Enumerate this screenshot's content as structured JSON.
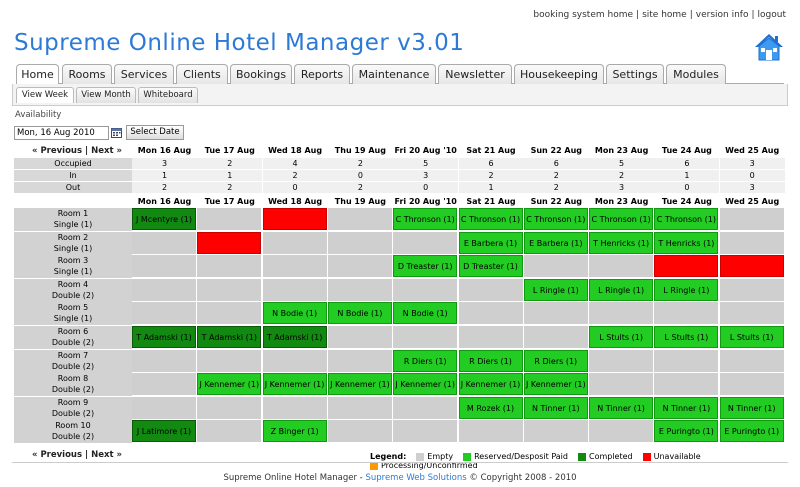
{
  "toplinks": [
    "booking system home",
    "site home",
    "version info",
    "logout"
  ],
  "title": "Supreme Online Hotel Manager v3.01",
  "tabs": [
    "Home",
    "Rooms",
    "Services",
    "Clients",
    "Bookings",
    "Reports",
    "Maintenance",
    "Newsletter",
    "Housekeeping",
    "Settings",
    "Modules"
  ],
  "subtabs": [
    "View Week",
    "View Month",
    "Whiteboard"
  ],
  "availability_label": "Availability",
  "date_value": "Mon, 16 Aug 2010",
  "select_date_label": "Select Date",
  "nav": {
    "prev": "« Previous",
    "sep": "|",
    "next": "Next »"
  },
  "days": [
    "Mon 16 Aug '10",
    "Tue 17 Aug '10",
    "Wed 18 Aug '10",
    "Thu 19 Aug '10",
    "Fri 20 Aug '10",
    "Sat 21 Aug '10",
    "Sun 22 Aug '10",
    "Mon 23 Aug '10",
    "Tue 24 Aug '10",
    "Wed 25 Aug '10"
  ],
  "stats": [
    {
      "label": "Occupied",
      "values": [
        "3",
        "2",
        "4",
        "2",
        "5",
        "6",
        "6",
        "5",
        "6",
        "3"
      ]
    },
    {
      "label": "In",
      "values": [
        "1",
        "1",
        "2",
        "0",
        "3",
        "2",
        "2",
        "2",
        "1",
        "0"
      ]
    },
    {
      "label": "Out",
      "values": [
        "2",
        "2",
        "0",
        "2",
        "0",
        "1",
        "2",
        "3",
        "0",
        "3"
      ]
    }
  ],
  "rooms": [
    {
      "name": "Room 1",
      "type": "Single (1)",
      "cells": [
        [
          "completed",
          "J Mcentyre (1)"
        ],
        [
          "",
          ""
        ],
        [
          "unavailable",
          ""
        ],
        [
          "",
          ""
        ],
        [
          "reserved",
          "C Thronson (1)"
        ],
        [
          "reserved",
          "C Thronson (1)"
        ],
        [
          "reserved",
          "C Thronson (1)"
        ],
        [
          "reserved",
          "C Thronson (1)"
        ],
        [
          "reserved",
          "C Thronson (1)"
        ],
        [
          "",
          ""
        ]
      ]
    },
    {
      "name": "Room 2",
      "type": "Single (1)",
      "cells": [
        [
          "",
          ""
        ],
        [
          "unavailable",
          ""
        ],
        [
          "",
          ""
        ],
        [
          "",
          ""
        ],
        [
          "",
          ""
        ],
        [
          "reserved",
          "E Barbera (1)"
        ],
        [
          "reserved",
          "E Barbera (1)"
        ],
        [
          "reserved",
          "T Henricks (1)"
        ],
        [
          "reserved",
          "T Henricks (1)"
        ],
        [
          "",
          ""
        ]
      ]
    },
    {
      "name": "Room 3",
      "type": "Single (1)",
      "cells": [
        [
          "",
          ""
        ],
        [
          "",
          ""
        ],
        [
          "",
          ""
        ],
        [
          "",
          ""
        ],
        [
          "reserved",
          "D Treaster (1)"
        ],
        [
          "reserved",
          "D Treaster (1)"
        ],
        [
          "",
          ""
        ],
        [
          "",
          ""
        ],
        [
          "unavailable",
          ""
        ],
        [
          "unavailable",
          ""
        ]
      ]
    },
    {
      "name": "Room 4",
      "type": "Double (2)",
      "cells": [
        [
          "",
          ""
        ],
        [
          "",
          ""
        ],
        [
          "",
          ""
        ],
        [
          "",
          ""
        ],
        [
          "",
          ""
        ],
        [
          "",
          ""
        ],
        [
          "reserved",
          "L Ringle (1)"
        ],
        [
          "reserved",
          "L Ringle (1)"
        ],
        [
          "reserved",
          "L Ringle (1)"
        ],
        [
          "",
          ""
        ]
      ]
    },
    {
      "name": "Room 5",
      "type": "Single (1)",
      "cells": [
        [
          "",
          ""
        ],
        [
          "",
          ""
        ],
        [
          "reserved",
          "N Bodie (1)"
        ],
        [
          "reserved",
          "N Bodie (1)"
        ],
        [
          "reserved",
          "N Bodie (1)"
        ],
        [
          "",
          ""
        ],
        [
          "",
          ""
        ],
        [
          "",
          ""
        ],
        [
          "",
          ""
        ],
        [
          "",
          ""
        ]
      ]
    },
    {
      "name": "Room 6",
      "type": "Double (2)",
      "cells": [
        [
          "completed",
          "T Adamski (1)"
        ],
        [
          "completed",
          "T Adamski (1)"
        ],
        [
          "completed",
          "T Adamski (1)"
        ],
        [
          "",
          ""
        ],
        [
          "",
          ""
        ],
        [
          "",
          ""
        ],
        [
          "",
          ""
        ],
        [
          "reserved",
          "L Stults (1)"
        ],
        [
          "reserved",
          "L Stults (1)"
        ],
        [
          "reserved",
          "L Stults (1)"
        ]
      ]
    },
    {
      "name": "Room 7",
      "type": "Double (2)",
      "cells": [
        [
          "",
          ""
        ],
        [
          "",
          ""
        ],
        [
          "",
          ""
        ],
        [
          "",
          ""
        ],
        [
          "reserved",
          "R Diers (1)"
        ],
        [
          "reserved",
          "R Diers (1)"
        ],
        [
          "reserved",
          "R Diers (1)"
        ],
        [
          "",
          ""
        ],
        [
          "",
          ""
        ],
        [
          "",
          ""
        ]
      ]
    },
    {
      "name": "Room 8",
      "type": "Double (2)",
      "cells": [
        [
          "",
          ""
        ],
        [
          "reserved",
          "J Kennemer (1)"
        ],
        [
          "reserved",
          "J Kennemer (1)"
        ],
        [
          "reserved",
          "J Kennemer (1)"
        ],
        [
          "reserved",
          "J Kennemer (1)"
        ],
        [
          "reserved",
          "J Kennemer (1)"
        ],
        [
          "reserved",
          "J Kennemer (1)"
        ],
        [
          "",
          ""
        ],
        [
          "",
          ""
        ],
        [
          "",
          ""
        ]
      ]
    },
    {
      "name": "Room 9",
      "type": "Double (2)",
      "cells": [
        [
          "",
          ""
        ],
        [
          "",
          ""
        ],
        [
          "",
          ""
        ],
        [
          "",
          ""
        ],
        [
          "",
          ""
        ],
        [
          "reserved",
          "M Rozek (1)"
        ],
        [
          "reserved",
          "N Tinner (1)"
        ],
        [
          "reserved",
          "N Tinner (1)"
        ],
        [
          "reserved",
          "N Tinner (1)"
        ],
        [
          "reserved",
          "N Tinner (1)"
        ]
      ]
    },
    {
      "name": "Room 10",
      "type": "Double (2)",
      "cells": [
        [
          "completed",
          "J Latimore (1)"
        ],
        [
          "",
          ""
        ],
        [
          "reserved",
          "Z Binger (1)"
        ],
        [
          "",
          ""
        ],
        [
          "",
          ""
        ],
        [
          "",
          ""
        ],
        [
          "",
          ""
        ],
        [
          "",
          ""
        ],
        [
          "reserved",
          "E Puringto (1)"
        ],
        [
          "reserved",
          "E Puringto (1)"
        ]
      ]
    }
  ],
  "legend": {
    "title": "Legend:",
    "items": [
      {
        "label": "Empty",
        "color": "#cfcfcf"
      },
      {
        "label": "Reserved/Desposit Paid",
        "color": "#22cc22"
      },
      {
        "label": "Completed",
        "color": "#128a12"
      },
      {
        "label": "Unavailable",
        "color": "#ff0000"
      },
      {
        "label": "Processing/Unconfirmed",
        "color": "#ff9900"
      }
    ]
  },
  "footer": {
    "app": "Supreme Online Hotel Manager",
    "dash": " - ",
    "company": "Supreme Web Solutions",
    "copy": " © Copyright 2008 - 2010"
  }
}
